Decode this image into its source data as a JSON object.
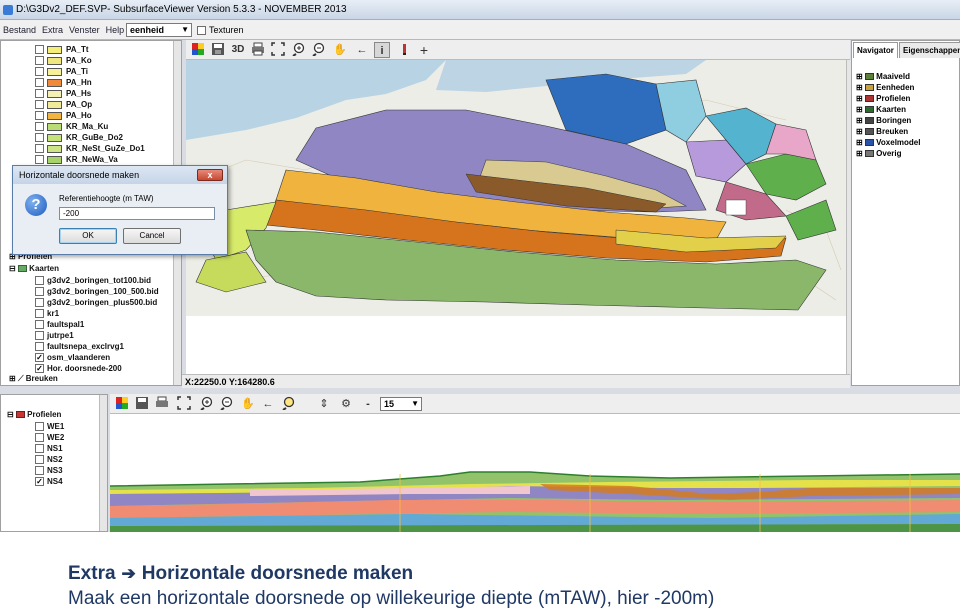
{
  "window": {
    "title": "D:\\G3Dv2_DEF.SVP- SubsurfaceViewer Version 5.3.3 - NOVEMBER 2013"
  },
  "menu": {
    "items": [
      "Bestand",
      "Extra",
      "Venster",
      "Help"
    ],
    "unit_value": "eenheid",
    "textures_label": "Texturen"
  },
  "map_toolbar": {
    "button_3d": "3D"
  },
  "layers": [
    {
      "label": "PA_Tt",
      "color": "#f3ef7a",
      "checked": false
    },
    {
      "label": "PA_Ko",
      "color": "#efe880",
      "checked": false
    },
    {
      "label": "PA_Ti",
      "color": "#f7f19a",
      "checked": false
    },
    {
      "label": "PA_Hn",
      "color": "#ef8a3c",
      "checked": false
    },
    {
      "label": "PA_Hs",
      "color": "#f6f0b6",
      "checked": false
    },
    {
      "label": "PA_Op",
      "color": "#f2ec9a",
      "checked": false
    },
    {
      "label": "PA_Ho",
      "color": "#f2b540",
      "checked": false
    },
    {
      "label": "KR_Ma_Ku",
      "color": "#b9dc74",
      "checked": false
    },
    {
      "label": "KR_GuBe_Do2",
      "color": "#c6e27a",
      "checked": false
    },
    {
      "label": "KR_NeSt_GuZe_Do1",
      "color": "#cde487",
      "checked": false
    },
    {
      "label": "KR_NeWa_Va",
      "color": "#a6d36a",
      "checked": false
    }
  ],
  "tree": {
    "profielen": "Profielen",
    "kaarten": "Kaarten",
    "maps": [
      {
        "label": "g3dv2_boringen_tot100.bid",
        "checked": false
      },
      {
        "label": "g3dv2_boringen_100_500.bid",
        "checked": false
      },
      {
        "label": "g3dv2_boringen_plus500.bid",
        "checked": false
      },
      {
        "label": "kr1",
        "checked": false
      },
      {
        "label": "faultspal1",
        "checked": false
      },
      {
        "label": "jutrpe1",
        "checked": false
      },
      {
        "label": "faultsnepa_exclrvg1",
        "checked": false
      },
      {
        "label": "osm_vlaanderen",
        "checked": true
      },
      {
        "label": "Hor. doorsnede-200",
        "checked": true
      }
    ],
    "breuken": "Breuken"
  },
  "dialog": {
    "title": "Horizontale doorsnede maken",
    "label": "Referentiehoogte (m TAW)",
    "value": "-200",
    "ok": "OK",
    "cancel": "Cancel",
    "close": "x"
  },
  "status": {
    "coordinates": "X:22250.0 Y:164280.6"
  },
  "navigator": {
    "tabs": [
      "Navigator",
      "Eigenschappen"
    ],
    "items": [
      "Maaiveld",
      "Eenheden",
      "Profielen",
      "Kaarten",
      "Boringen",
      "Breuken",
      "Voxelmodel",
      "Overig"
    ]
  },
  "profiles": {
    "root": "Profielen",
    "items": [
      {
        "label": "WE1",
        "checked": false
      },
      {
        "label": "WE2",
        "checked": false
      },
      {
        "label": "NS1",
        "checked": false
      },
      {
        "label": "NS2",
        "checked": false
      },
      {
        "label": "NS3",
        "checked": false
      },
      {
        "label": "NS4",
        "checked": true
      }
    ]
  },
  "section_toolbar": {
    "minus": "-",
    "zoom_value": "15"
  },
  "caption": {
    "menu": "Extra",
    "action": "Horizontale doorsnede maken",
    "description": "Maak een horizontale doorsnede op willekeurige diepte (mTAW), hier -200m)"
  }
}
